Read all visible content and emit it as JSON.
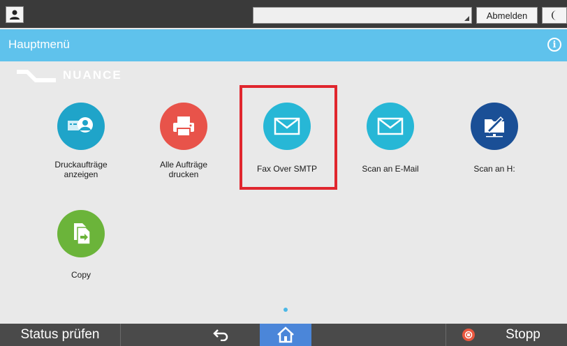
{
  "topbar": {
    "logout_label": "Abmelden"
  },
  "header": {
    "title": "Hauptmenü"
  },
  "logo": {
    "text": "NUANCE"
  },
  "apps": [
    {
      "label": "Druckaufträge anzeigen",
      "color": "#1fa4c9",
      "icon": "print-jobs-icon"
    },
    {
      "label": "Alle Aufträge drucken",
      "color": "#e8534a",
      "icon": "printer-icon"
    },
    {
      "label": "Fax Over SMTP",
      "color": "#27b7d6",
      "icon": "envelope-icon"
    },
    {
      "label": "Scan an E-Mail",
      "color": "#27b7d6",
      "icon": "envelope-icon"
    },
    {
      "label": "Scan an H:",
      "color": "#1a4f96",
      "icon": "scan-folder-icon"
    },
    {
      "label": "Copy",
      "color": "#6bb43a",
      "icon": "copy-icon"
    }
  ],
  "bottombar": {
    "status_label": "Status prüfen",
    "stop_label": "Stopp"
  },
  "colors": {
    "accent": "#5fc2ec",
    "highlight": "#e0262e",
    "home": "#4b86d9",
    "stop": "#e9573f"
  }
}
